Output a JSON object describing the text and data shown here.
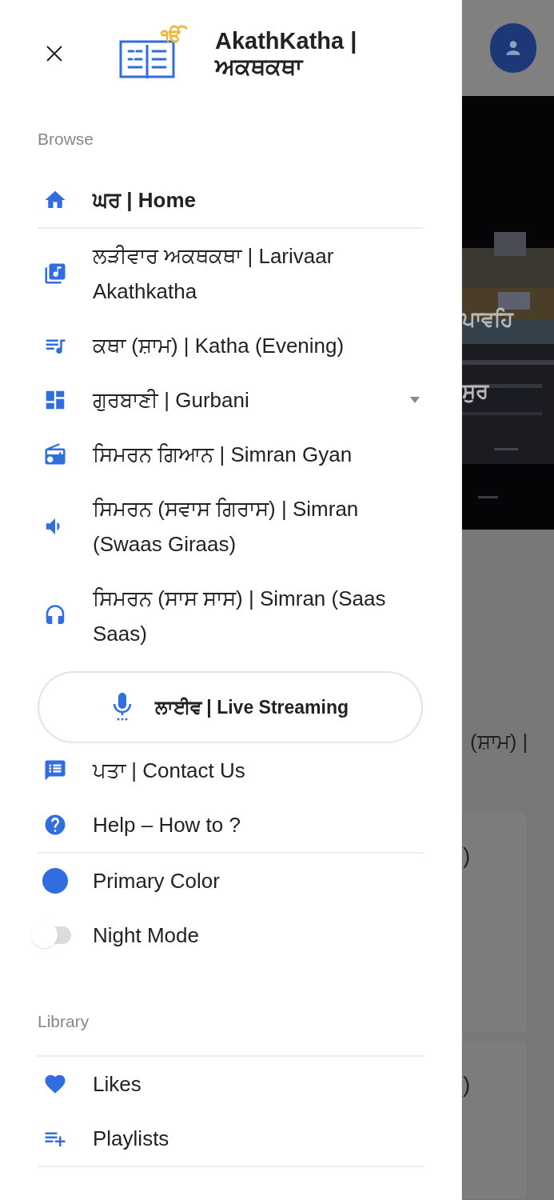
{
  "drawer": {
    "logo_mark": "ੴ",
    "title": "AkathKatha | ਅਕਥਕਥਾ",
    "browse_label": "Browse",
    "nav_items": [
      {
        "label": "ਘਰ | Home",
        "selected": true,
        "kind": "link"
      },
      {
        "label": "ਲੜੀਵਾਰ ਅਕਥਕਥਾ | Larivaar Akathkatha",
        "selected": false,
        "kind": "link"
      },
      {
        "label": "ਕਥਾ (ਸ਼ਾਮ) | Katha (Evening)",
        "selected": false,
        "kind": "link"
      },
      {
        "label": "ਗੁਰਬਾਣੀ | Gurbani",
        "selected": false,
        "kind": "dropdown"
      },
      {
        "label": "ਸਿਮਰਨ ਗਿਆਨ | Simran Gyan",
        "selected": false,
        "kind": "link"
      },
      {
        "label": "ਸਿਮਰਨ (ਸਵਾਸ ਗਿਰਾਸ) | Simran (Swaas Giraas)",
        "selected": false,
        "kind": "link"
      },
      {
        "label": "ਸਿਮਰਨ (ਸਾਸ ਸਾਸ) | Simran (Saas Saas)",
        "selected": false,
        "kind": "link"
      }
    ],
    "live_button": "ਲਾਈਵ | Live Streaming",
    "info_items": [
      {
        "label": "ਪਤਾ | Contact Us"
      },
      {
        "label": "Help – How to ?"
      }
    ],
    "settings": [
      {
        "kind": "color",
        "label": "Primary Color",
        "color": "#2f6de1"
      },
      {
        "kind": "toggle",
        "label": "Night Mode",
        "on": false
      }
    ],
    "library_label": "Library",
    "library_items": [
      {
        "label": "Likes"
      },
      {
        "label": "Playlists"
      }
    ]
  },
  "background_app": {
    "banner_captions": [
      "ਪਾਵਹਿ",
      "ਸੁਰ"
    ],
    "section_text": "(ਸ਼ਾਮ) |",
    "card_texts": [
      ")",
      ")"
    ]
  }
}
